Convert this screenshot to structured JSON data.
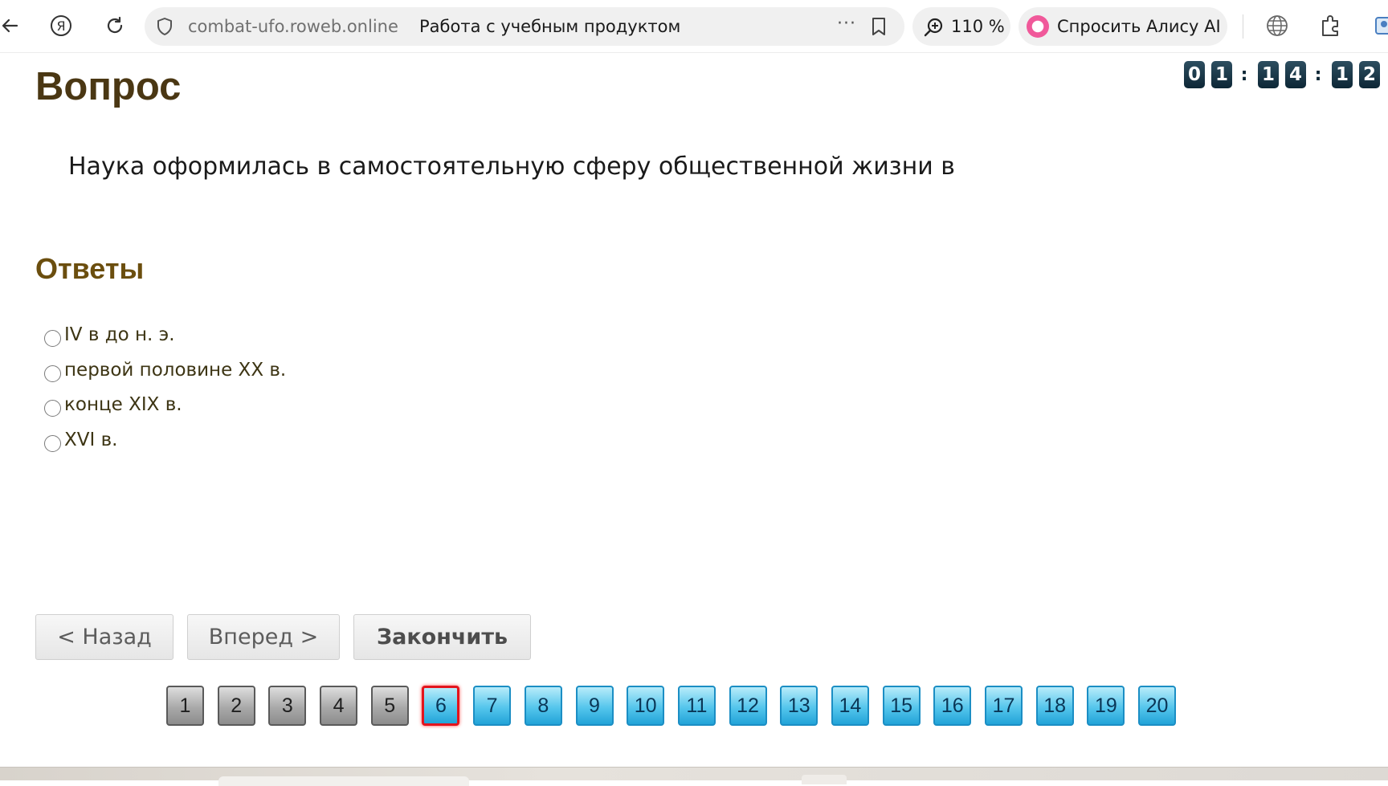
{
  "browser": {
    "address_domain": "combat-ufo.roweb.online",
    "page_title": "Работа с учебным продуктом",
    "more_glyph": "···",
    "zoom_value": "110 %",
    "alice_label": "Спросить Алису AI"
  },
  "timer": {
    "digits": [
      "0",
      "1",
      "1",
      "4",
      "1",
      "2"
    ],
    "separator": ":"
  },
  "question": {
    "heading": "Вопрос",
    "text": "Наука оформилась в самостоятельную сферу общественной жизни в"
  },
  "answers": {
    "heading": "Ответы",
    "options": [
      {
        "label": "IV в до н. э.",
        "selected": false
      },
      {
        "label": "первой половине XX в.",
        "selected": false
      },
      {
        "label": "конце XIX в.",
        "selected": false
      },
      {
        "label": "XVI в.",
        "selected": false
      }
    ]
  },
  "nav": {
    "back_label": "< Назад",
    "next_label": "Вперед >",
    "finish_label": "Закончить"
  },
  "pager": {
    "pages": [
      "1",
      "2",
      "3",
      "4",
      "5",
      "6",
      "7",
      "8",
      "9",
      "10",
      "11",
      "12",
      "13",
      "14",
      "15",
      "16",
      "17",
      "18",
      "19",
      "20"
    ],
    "current_page": "6",
    "answered_pages": [
      "1",
      "2",
      "3",
      "4",
      "5"
    ]
  },
  "colors": {
    "question_heading": "#4a3713",
    "answers_heading": "#6b4e0e",
    "timer_digit_bg": "#0d2736",
    "page_done": "#8c8c8c",
    "page_todo": "#55c6ec",
    "page_current_border": "#e3141d",
    "alice_brand": "#f0599a"
  }
}
